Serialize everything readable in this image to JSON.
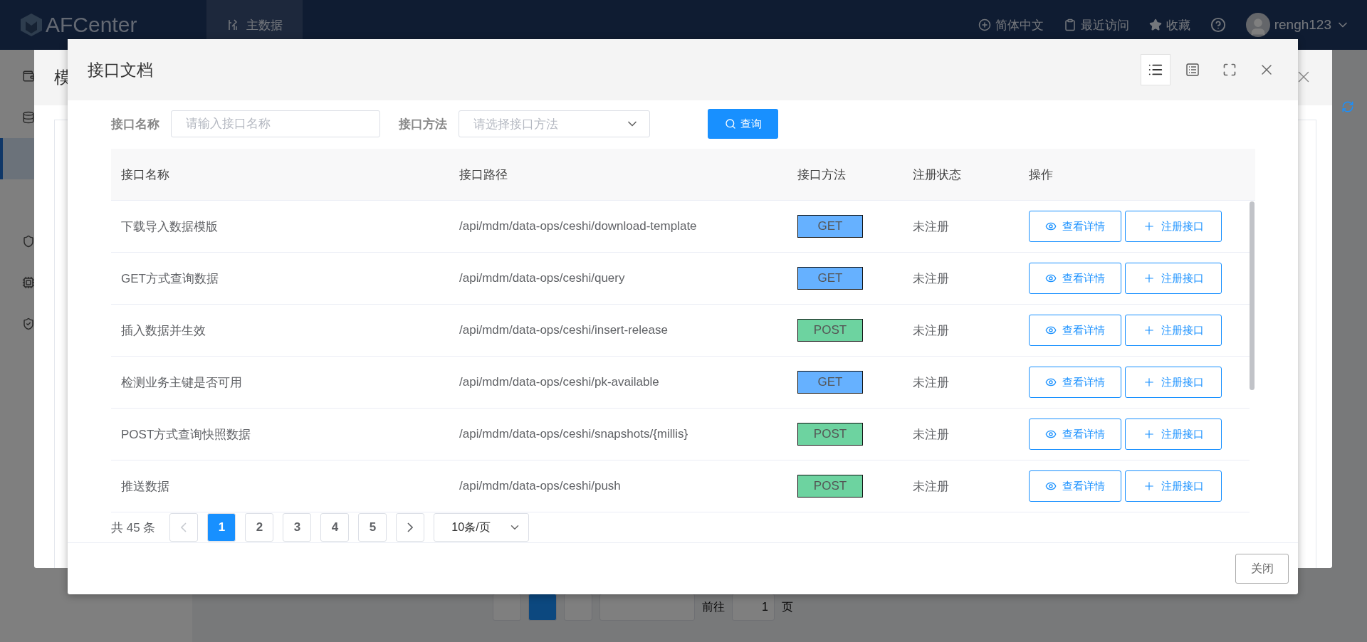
{
  "app_header": {
    "logo": "AFCenter",
    "nav": [
      {
        "label": "主数据",
        "selected": true
      }
    ],
    "actions": [
      {
        "kind": "language",
        "label": "简体中文"
      },
      {
        "kind": "recent",
        "label": "最近访问"
      },
      {
        "kind": "favorite",
        "label": "收藏"
      },
      {
        "kind": "help"
      }
    ],
    "user": "rengh123"
  },
  "sidebar": {
    "items": [
      {
        "kind": "wallet",
        "selected": false
      },
      {
        "kind": "database",
        "selected": false
      },
      {
        "kind": "blank",
        "selected": true
      },
      {
        "kind": "blank",
        "selected": false
      },
      {
        "kind": "shield",
        "selected": false
      },
      {
        "kind": "chip",
        "selected": false
      },
      {
        "kind": "account",
        "selected": false
      }
    ]
  },
  "background_pager": {
    "jump_label": "前往",
    "page_input": "1",
    "page_unit": "页"
  },
  "back_dialog": {
    "title": "模"
  },
  "dialog": {
    "title": "接口文档",
    "toolbar": [
      {
        "kind": "list",
        "selected": true
      },
      {
        "kind": "outline",
        "selected": false
      },
      {
        "kind": "fullscreen",
        "selected": false
      },
      {
        "kind": "close",
        "selected": false
      }
    ],
    "filters": [
      {
        "kind": "input",
        "label": "接口名称",
        "placeholder": "请输入接口名称"
      },
      {
        "kind": "select",
        "label": "接口方法",
        "placeholder": "请选择接口方法"
      }
    ],
    "search_button": "查询",
    "table": {
      "columns": [
        "接口名称",
        "接口路径",
        "接口方法",
        "注册状态",
        "操作"
      ],
      "rows": [
        {
          "name": "下载导入数据模版",
          "path": "/api/mdm/data-ops/ceshi/download-template",
          "method": {
            "label": "GET",
            "color": "#66b1ff"
          },
          "status": "未注册",
          "actions": [
            {
              "kind": "view",
              "label": "查看详情"
            },
            {
              "kind": "register",
              "label": "注册接口"
            }
          ]
        },
        {
          "name": "GET方式查询数据",
          "path": "/api/mdm/data-ops/ceshi/query",
          "method": {
            "label": "GET",
            "color": "#66b1ff"
          },
          "status": "未注册",
          "actions": [
            {
              "kind": "view",
              "label": "查看详情"
            },
            {
              "kind": "register",
              "label": "注册接口"
            }
          ]
        },
        {
          "name": "插入数据并生效",
          "path": "/api/mdm/data-ops/ceshi/insert-release",
          "method": {
            "label": "POST",
            "color": "#6dd3a0"
          },
          "status": "未注册",
          "actions": [
            {
              "kind": "view",
              "label": "查看详情"
            },
            {
              "kind": "register",
              "label": "注册接口"
            }
          ]
        },
        {
          "name": "检测业务主键是否可用",
          "path": "/api/mdm/data-ops/ceshi/pk-available",
          "method": {
            "label": "GET",
            "color": "#66b1ff"
          },
          "status": "未注册",
          "actions": [
            {
              "kind": "view",
              "label": "查看详情"
            },
            {
              "kind": "register",
              "label": "注册接口"
            }
          ]
        },
        {
          "name": "POST方式查询快照数据",
          "path": "/api/mdm/data-ops/ceshi/snapshots/{millis}",
          "method": {
            "label": "POST",
            "color": "#6dd3a0"
          },
          "status": "未注册",
          "actions": [
            {
              "kind": "view",
              "label": "查看详情"
            },
            {
              "kind": "register",
              "label": "注册接口"
            }
          ]
        },
        {
          "name": "推送数据",
          "path": "/api/mdm/data-ops/ceshi/push",
          "method": {
            "label": "POST",
            "color": "#6dd3a0"
          },
          "status": "未注册",
          "actions": [
            {
              "kind": "view",
              "label": "查看详情"
            },
            {
              "kind": "register",
              "label": "注册接口"
            }
          ]
        }
      ]
    },
    "pagination": {
      "total": "共 45 条",
      "prev": {
        "disabled": true
      },
      "pages": [
        {
          "label": "1",
          "selected": true
        },
        {
          "label": "2",
          "selected": false
        },
        {
          "label": "3",
          "selected": false
        },
        {
          "label": "4",
          "selected": false
        },
        {
          "label": "5",
          "selected": false
        }
      ],
      "next": {
        "disabled": false
      },
      "page_size": "10条/页"
    },
    "footer_button": "关闭"
  }
}
